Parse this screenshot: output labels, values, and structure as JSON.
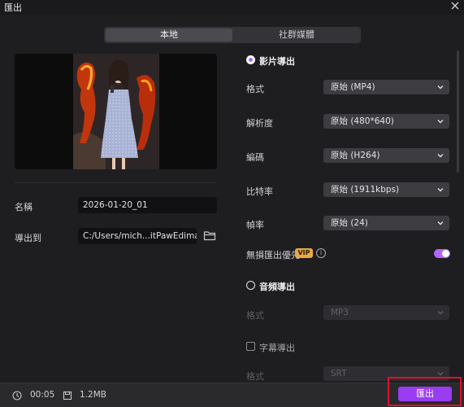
{
  "window": {
    "title": "匯出"
  },
  "tabs": [
    {
      "label": "本地",
      "active": true
    },
    {
      "label": "社群媒體",
      "active": false
    }
  ],
  "left": {
    "name_label": "名稱",
    "name_value": "2026-01-20_01",
    "path_label": "導出到",
    "path_value": "C:/Users/mich...itPawEdimakor"
  },
  "video_section": {
    "title": "影片導出",
    "selected": true,
    "rows": [
      {
        "label": "格式",
        "value": "原始 (MP4)"
      },
      {
        "label": "解析度",
        "value": "原始 (480*640)"
      },
      {
        "label": "編碼",
        "value": "原始 (H264)"
      },
      {
        "label": "比特率",
        "value": "原始 (1911kbps)"
      },
      {
        "label": "幀率",
        "value": "原始 (24)"
      }
    ],
    "lossless_label": "無損匯出優先",
    "vip_badge": "VIP",
    "info_glyph": "i",
    "lossless_enabled": true
  },
  "audio_section": {
    "title": "音頻導出",
    "selected": false,
    "format_label": "格式",
    "format_value": "MP3"
  },
  "subtitle_section": {
    "title": "字幕導出",
    "checked": false,
    "format_label": "格式",
    "format_value": "SRT"
  },
  "footer": {
    "duration": "00:05",
    "size": "1.2MB",
    "export_label": "匯出"
  },
  "colors": {
    "accent": "#9a3cf2",
    "vip": "#e9a845",
    "highlight": "#e0102a"
  }
}
